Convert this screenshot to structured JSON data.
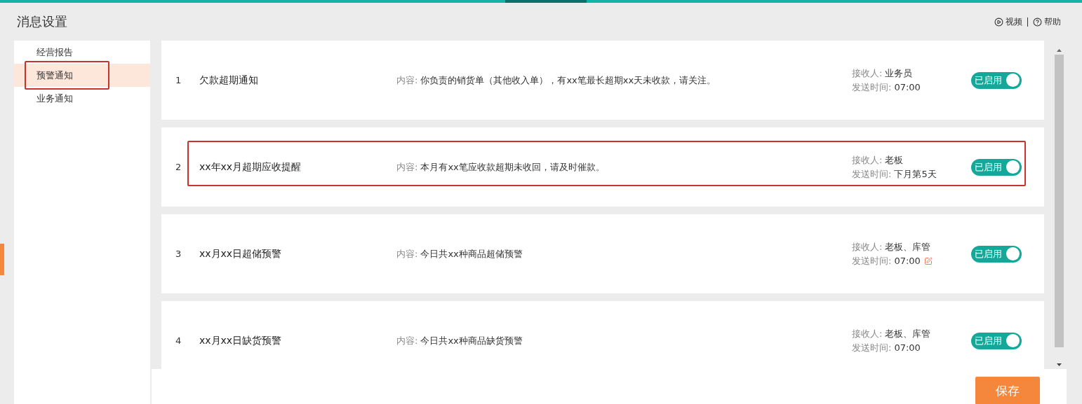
{
  "page": {
    "title": "消息设置"
  },
  "header_links": [
    {
      "kind": "video",
      "label": "视频"
    },
    {
      "kind": "help",
      "label": "帮助"
    }
  ],
  "sidebar": {
    "items": [
      {
        "label": "经营报告",
        "selected": false,
        "highlighted": false
      },
      {
        "label": "预警通知",
        "selected": true,
        "highlighted": true
      },
      {
        "label": "业务通知",
        "selected": false,
        "highlighted": false
      }
    ]
  },
  "notifications": [
    {
      "index": "1",
      "title": "欠款超期通知",
      "content_label": "内容:",
      "content": "你负责的销货单（其他收入单），有xx笔最长超期xx天未收款，请关注。",
      "recipient_label": "接收人:",
      "recipient": "业务员",
      "time_label": "发送时间:",
      "time": "07:00",
      "editable": false,
      "highlighted": false,
      "toggle": {
        "label": "已启用",
        "on": true
      }
    },
    {
      "index": "2",
      "title": "xx年xx月超期应收提醒",
      "content_label": "内容:",
      "content": "本月有xx笔应收款超期未收回，请及时催款。",
      "recipient_label": "接收人:",
      "recipient": "老板",
      "time_label": "发送时间:",
      "time": "下月第5天",
      "editable": false,
      "highlighted": true,
      "toggle": {
        "label": "已启用",
        "on": true
      }
    },
    {
      "index": "3",
      "title": "xx月xx日超储预警",
      "content_label": "内容:",
      "content": "今日共xx种商品超储预警",
      "recipient_label": "接收人:",
      "recipient": "老板、库管",
      "time_label": "发送时间:",
      "time": "07:00",
      "editable": true,
      "highlighted": false,
      "toggle": {
        "label": "已启用",
        "on": true
      }
    },
    {
      "index": "4",
      "title": "xx月xx日缺货预警",
      "content_label": "内容:",
      "content": "今日共xx种商品缺货预警",
      "recipient_label": "接收人:",
      "recipient": "老板、库管",
      "time_label": "发送时间:",
      "time": "07:00",
      "editable": false,
      "highlighted": false,
      "toggle": {
        "label": "已启用",
        "on": true
      }
    }
  ],
  "footer": {
    "save_button": "保存"
  }
}
